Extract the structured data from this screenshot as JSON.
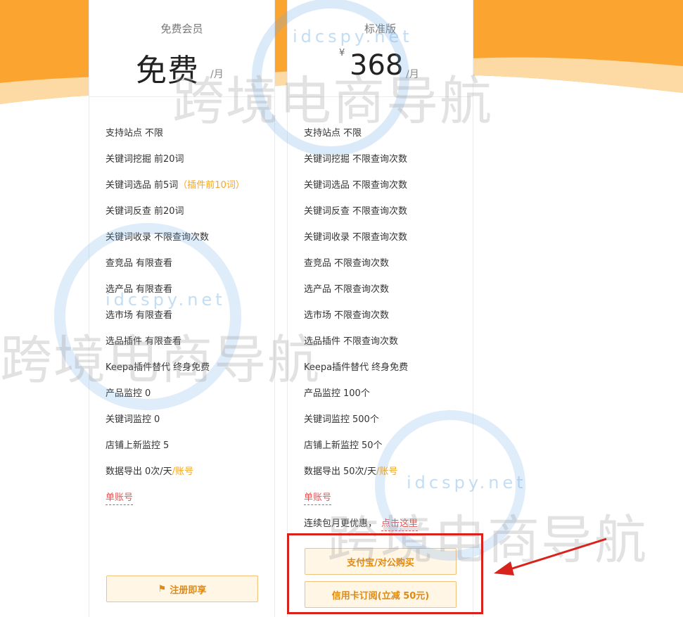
{
  "colors": {
    "accent": "#f5a623",
    "link_red": "#e25656",
    "button_text": "#e08a10",
    "button_bg": "#fff6e6",
    "highlight_red": "#d8231c",
    "background_orange": "#fba530"
  },
  "watermark": {
    "cn": "跨境电商导航",
    "en": "idcspy.net"
  },
  "free_plan": {
    "name": "免费会员",
    "price": "免费",
    "per": "/月",
    "features": [
      {
        "label": "支持站点",
        "value": "不限"
      },
      {
        "label": "关键词挖掘",
        "value": "前20词"
      },
      {
        "label": "关键词选品",
        "value": "前5词",
        "note": "（插件前10词）"
      },
      {
        "label": "关键词反查",
        "value": "前20词"
      },
      {
        "label": "关键词收录",
        "value": "不限查询次数"
      },
      {
        "label": "查竞品",
        "value": "有限查看"
      },
      {
        "label": "选产品",
        "value": "有限查看"
      },
      {
        "label": "选市场",
        "value": "有限查看"
      },
      {
        "label": "选品插件",
        "value": "有限查看"
      },
      {
        "label": "Keepa插件替代",
        "value": "终身免费"
      },
      {
        "label": "产品监控",
        "value": "0"
      },
      {
        "label": "关键词监控",
        "value": "0"
      },
      {
        "label": "店铺上新监控",
        "value": "5"
      },
      {
        "label": "数据导出",
        "value": "0次/天",
        "sep": "/",
        "note": "账号"
      }
    ],
    "account_note": "单账号",
    "register_button": "注册即享",
    "register_icon": "flag-icon"
  },
  "standard_plan": {
    "name": "标准版",
    "currency": "¥",
    "price": "368",
    "per": "/月",
    "features": [
      {
        "label": "支持站点",
        "value": "不限"
      },
      {
        "label": "关键词挖掘",
        "value": "不限查询次数"
      },
      {
        "label": "关键词选品",
        "value": "不限查询次数"
      },
      {
        "label": "关键词反查",
        "value": "不限查询次数"
      },
      {
        "label": "关键词收录",
        "value": "不限查询次数"
      },
      {
        "label": "查竞品",
        "value": "不限查询次数"
      },
      {
        "label": "选产品",
        "value": "不限查询次数"
      },
      {
        "label": "选市场",
        "value": "不限查询次数"
      },
      {
        "label": "选品插件",
        "value": "不限查询次数"
      },
      {
        "label": "Keepa插件替代",
        "value": "终身免费"
      },
      {
        "label": "产品监控",
        "value": "100个"
      },
      {
        "label": "关键词监控",
        "value": "500个"
      },
      {
        "label": "店铺上新监控",
        "value": "50个"
      },
      {
        "label": "数据导出",
        "value": "50次/天",
        "sep": "/",
        "note": "账号"
      }
    ],
    "account_note": "单账号",
    "promo_text": "连续包月更优惠，",
    "promo_link": "点击这里",
    "alipay_button": "支付宝/对公购买",
    "credit_button": "信用卡订阅(立减 50元)"
  }
}
